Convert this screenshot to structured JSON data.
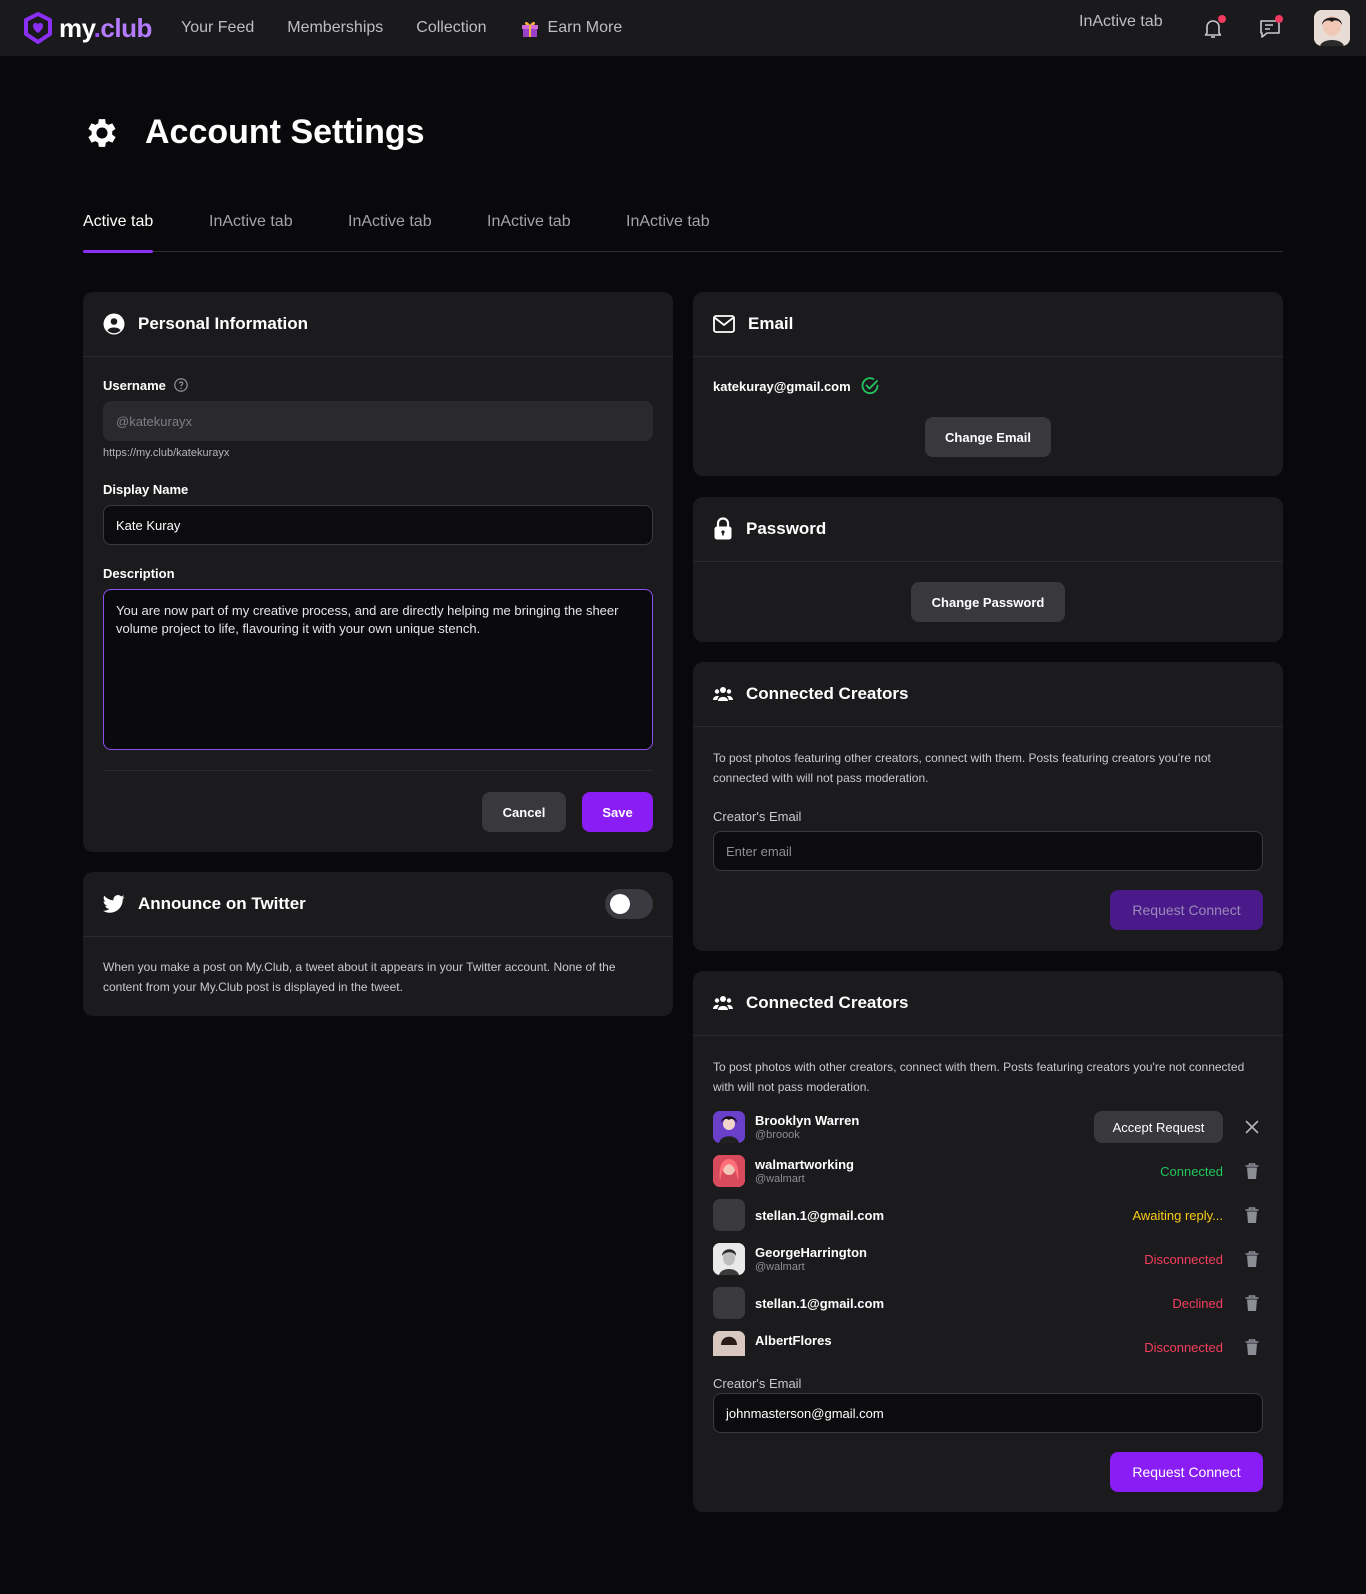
{
  "nav": {
    "logo_text_a": "my",
    "logo_text_b": ".",
    "logo_text_c": "club",
    "items": [
      "Your Feed",
      "Memberships",
      "Collection",
      "Earn More"
    ],
    "right_tab": "InActive tab"
  },
  "page": {
    "title": "Account Settings"
  },
  "tabs": [
    "Active tab",
    "InActive tab",
    "InActive tab",
    "InActive tab",
    "InActive tab"
  ],
  "personal": {
    "title": "Personal Information",
    "username_label": "Username",
    "username_value": "@katekurayx",
    "username_url": "https://my.club/katekurayx",
    "display_label": "Display Name",
    "display_value": "Kate Kuray",
    "description_label": "Description",
    "description_value": "You are now part of my creative process, and are directly helping me bringing the sheer volume project to life, flavouring it with your own unique stench.",
    "cancel": "Cancel",
    "save": "Save"
  },
  "twitter": {
    "title": "Announce on Twitter",
    "toggle_on": false,
    "desc": "When you make a post on My.Club, a tweet about it appears in your Twitter account. None of the content from your My.Club post is displayed in the tweet."
  },
  "email": {
    "title": "Email",
    "value": "katekuray@gmail.com",
    "change": "Change Email"
  },
  "password": {
    "title": "Password",
    "change": "Change Password"
  },
  "connected1": {
    "title": "Connected Creators",
    "desc": "To post photos featuring other creators, connect with them. Posts featuring creators you're not connected with will not pass moderation.",
    "email_label": "Creator's Email",
    "email_placeholder": "Enter email",
    "button": "Request Connect"
  },
  "connected2": {
    "title": "Connected Creators",
    "desc": "To post photos with other creators, connect with them. Posts featuring creators you're not connected with will not pass moderation.",
    "creators": [
      {
        "name": "Brooklyn Warren",
        "handle": "@broook",
        "status": "",
        "action": "Accept Request"
      },
      {
        "name": "walmartworking",
        "handle": "@walmart",
        "status": "Connected",
        "action": ""
      },
      {
        "name": "stellan.1@gmail.com",
        "handle": "",
        "status": "Awaiting reply...",
        "action": ""
      },
      {
        "name": "GeorgeHarrington",
        "handle": "@walmart",
        "status": "Disconnected",
        "action": ""
      },
      {
        "name": "stellan.1@gmail.com",
        "handle": "",
        "status": "Declined",
        "action": ""
      },
      {
        "name": "AlbertFlores",
        "handle": "",
        "status": "Disconnected",
        "action": ""
      }
    ],
    "email_label": "Creator's Email",
    "email_value": "johnmasterson@gmail.com",
    "button": "Request Connect"
  },
  "colors": {
    "accent": "#8a1cf5",
    "connected": "#22c55e",
    "awaiting": "#facc15",
    "disconnected": "#f43f5e"
  }
}
